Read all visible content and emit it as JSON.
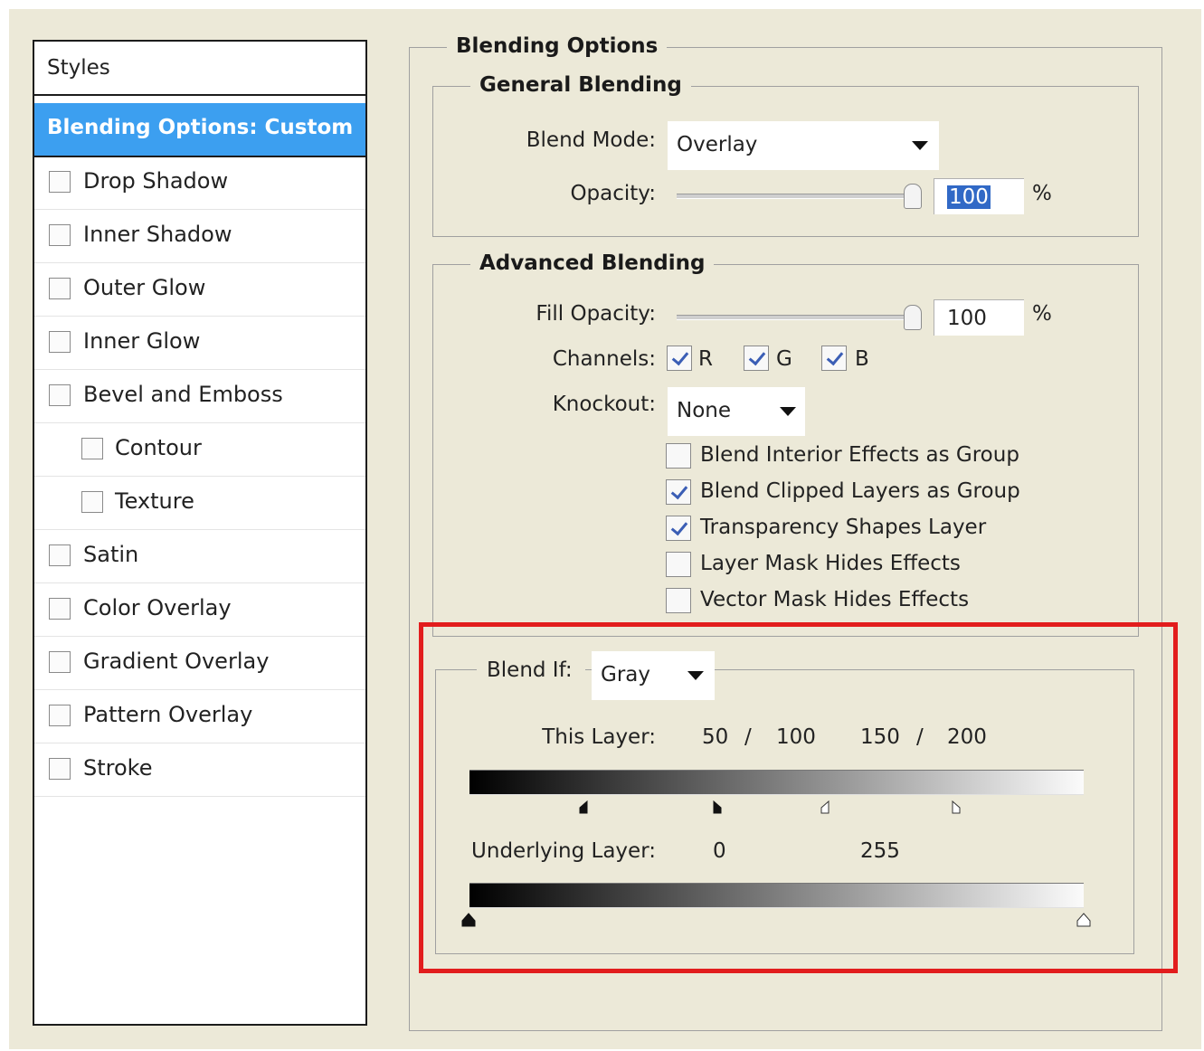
{
  "styles_panel": {
    "header": "Styles",
    "selected": "Blending Options: Custom",
    "items": [
      {
        "label": "Drop Shadow",
        "checked": false
      },
      {
        "label": "Inner Shadow",
        "checked": false
      },
      {
        "label": "Outer Glow",
        "checked": false
      },
      {
        "label": "Inner Glow",
        "checked": false
      },
      {
        "label": "Bevel and Emboss",
        "checked": false
      },
      {
        "label": "Contour",
        "checked": false
      },
      {
        "label": "Texture",
        "checked": false
      },
      {
        "label": "Satin",
        "checked": false
      },
      {
        "label": "Color Overlay",
        "checked": false
      },
      {
        "label": "Gradient Overlay",
        "checked": false
      },
      {
        "label": "Pattern Overlay",
        "checked": false
      },
      {
        "label": "Stroke",
        "checked": false
      }
    ]
  },
  "blending_options": {
    "title": "Blending Options",
    "general": {
      "title": "General Blending",
      "blend_mode_label": "Blend Mode:",
      "blend_mode_value": "Overlay",
      "opacity_label": "Opacity:",
      "opacity_value": "100",
      "opacity_unit": "%"
    },
    "advanced": {
      "title": "Advanced Blending",
      "fill_opacity_label": "Fill Opacity:",
      "fill_opacity_value": "100",
      "fill_opacity_unit": "%",
      "channels_label": "Channels:",
      "channels": [
        {
          "label": "R",
          "checked": true
        },
        {
          "label": "G",
          "checked": true
        },
        {
          "label": "B",
          "checked": true
        }
      ],
      "knockout_label": "Knockout:",
      "knockout_value": "None",
      "options": [
        {
          "label": "Blend Interior Effects as Group",
          "checked": false
        },
        {
          "label": "Blend Clipped Layers as Group",
          "checked": true
        },
        {
          "label": "Transparency Shapes Layer",
          "checked": true
        },
        {
          "label": "Layer Mask Hides Effects",
          "checked": false
        },
        {
          "label": "Vector Mask Hides Effects",
          "checked": false
        }
      ]
    },
    "blend_if": {
      "label": "Blend If:",
      "value": "Gray",
      "this_layer_label": "This Layer:",
      "this_layer_values": [
        "50",
        "/",
        "100",
        "150",
        "/",
        "200"
      ],
      "underlying_layer_label": "Underlying Layer:",
      "underlying_values": [
        "0",
        "255"
      ]
    }
  },
  "colors": {
    "dialog_bg": "#ece9d8",
    "selection": "#3c9ff0",
    "highlight_border": "#e21d1d",
    "checkmark": "#3b5eb5"
  }
}
